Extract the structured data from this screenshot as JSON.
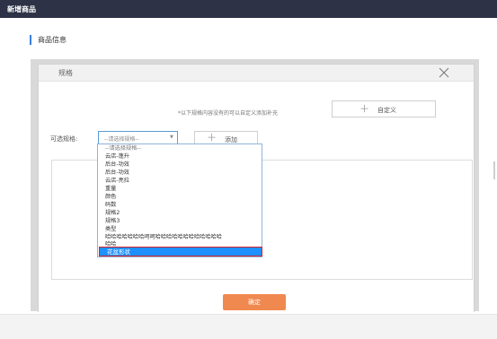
{
  "topbar": {
    "title": "新增商品"
  },
  "section": {
    "title": "商品信息"
  },
  "dialog": {
    "title": "规格",
    "hint": "*以下规格内容没有的可以自定义添加补充",
    "custom_button": "自定义",
    "select_label": "可选规格:",
    "select_value": "--请选择规格--",
    "add_button": "添加",
    "confirm_button": "确定"
  },
  "dropdown": {
    "options": [
      "--请选择规格--",
      "云店-蓬升",
      "后台-功效",
      "后台-功效",
      "云店-亮拉",
      "重量",
      "颜色",
      "码数",
      "规格2",
      "规格3",
      "类型",
      "哈哈哈哈哈哈哈呵呵哈哈哈哈哈哈哈哈哈哈哈哈",
      "哈哈"
    ],
    "selected": "花盆形状"
  },
  "colors": {
    "topbar": "#2d3246",
    "accent": "#3b7ddd",
    "confirm": "#f0894f",
    "selected": "#1e90ff",
    "highlight_border": "#d9222a"
  }
}
